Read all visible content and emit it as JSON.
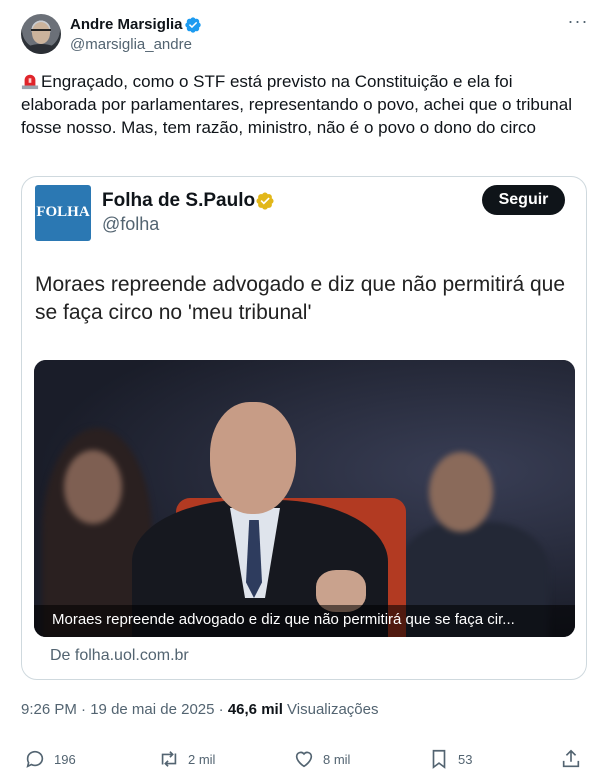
{
  "author": {
    "name": "Andre Marsiglia",
    "handle": "@marsiglia_andre"
  },
  "tweet": {
    "emoji_icon": "rotating-light-siren",
    "text": "Engraçado, como o STF está previsto na Constituição e ela foi elaborada por parlamentares, representando o povo, achei que o tribunal fosse nosso. Mas, tem razão, ministro, não é o povo o dono do circo"
  },
  "quoted": {
    "logo_text": "FOLHA",
    "name": "Folha de S.Paulo",
    "handle": "@folha",
    "follow_label": "Seguir",
    "headline": "Moraes repreende advogado e diz que não permitirá que se faça circo no 'meu tribunal'",
    "image_caption": "Moraes repreende advogado e diz que não permitirá que se faça cir...",
    "source": "De folha.uol.com.br"
  },
  "meta": {
    "time": "9:26 PM",
    "separator": "·",
    "date": "19 de mai de 2025",
    "views_count": "46,6 mil",
    "views_label": "Visualizações"
  },
  "actions": {
    "replies": "196",
    "retweets": "2 mil",
    "likes": "8 mil",
    "bookmarks": "53"
  },
  "colors": {
    "text_primary": "#0f1419",
    "text_secondary": "#536471",
    "verified_blue": "#1d9bf0",
    "verified_gold": "#e2b719",
    "folha_blue": "#2b78b3",
    "border": "#cfd9de"
  }
}
